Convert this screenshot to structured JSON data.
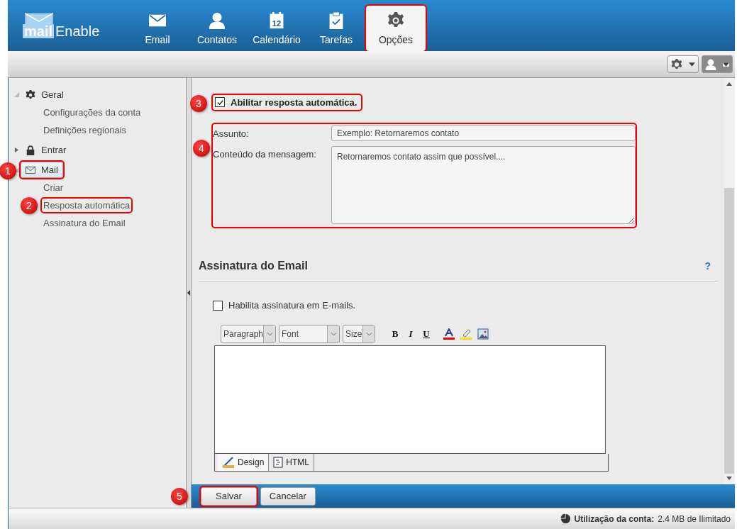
{
  "header": {
    "logo": {
      "part1": "mail",
      "part2": "Enable"
    },
    "tabs": [
      {
        "label": "Email",
        "kind": "envelope",
        "selected": false,
        "highlighted": false
      },
      {
        "label": "Contatos",
        "kind": "person",
        "selected": false,
        "highlighted": false
      },
      {
        "label": "Calendário",
        "kind": "calendar",
        "icon_text": "12",
        "selected": false,
        "highlighted": false
      },
      {
        "label": "Tarefas",
        "kind": "clipboard",
        "selected": false,
        "highlighted": false
      },
      {
        "label": "Opções",
        "kind": "gear",
        "selected": true,
        "highlighted": true
      }
    ]
  },
  "sidebar": {
    "items": [
      {
        "label": "Geral",
        "kind": "gear",
        "expanded": true,
        "selected": false,
        "highlighted": false,
        "children": [
          {
            "label": "Configurações da conta",
            "highlighted": false
          },
          {
            "label": "Definições regionais",
            "highlighted": false
          }
        ]
      },
      {
        "label": "Entrar",
        "kind": "lock",
        "expanded": false,
        "selected": false,
        "highlighted": false
      },
      {
        "label": "Mail",
        "kind": "envelope",
        "expanded": true,
        "selected": true,
        "highlighted": true,
        "callout": "1",
        "children": [
          {
            "label": "Criar",
            "highlighted": false
          },
          {
            "label": "Resposta automática",
            "highlighted": true,
            "callout": "2"
          },
          {
            "label": "Assinatura do Email",
            "highlighted": false
          }
        ]
      }
    ]
  },
  "auto_reply": {
    "label": "Abilitar resposta automática.",
    "checked": true,
    "highlighted": true,
    "callout": "3",
    "form": {
      "highlighted": true,
      "callout": "4",
      "subject_label": "Assunto:",
      "subject_value": "Exemplo: Retornaremos contato",
      "message_label": "Conteúdo da mensagem:",
      "message_value": "Retornaremos contato assim que possível...."
    }
  },
  "signature": {
    "title": "Assinatura do Email",
    "help": "?",
    "checkbox_label": "Habilita assinatura em E-mails.",
    "checked": false,
    "editor": {
      "dropdowns": [
        "Paragraph",
        "Font",
        "Size"
      ],
      "format_buttons": [
        {
          "label": "B",
          "kind": "bold"
        },
        {
          "label": "I",
          "kind": "italic"
        },
        {
          "label": "U",
          "kind": "underline"
        }
      ],
      "tabs": [
        {
          "label": "Design",
          "kind": "design",
          "selected": true
        },
        {
          "label": "HTML",
          "kind": "html",
          "selected": false
        }
      ]
    }
  },
  "buttons": [
    {
      "label": "Salvar",
      "highlighted": true,
      "callout": "5"
    },
    {
      "label": "Cancelar",
      "highlighted": false
    }
  ],
  "status_bar": {
    "label": "Utilização da conta:",
    "value": "2.4 MB de Ilimitado"
  }
}
